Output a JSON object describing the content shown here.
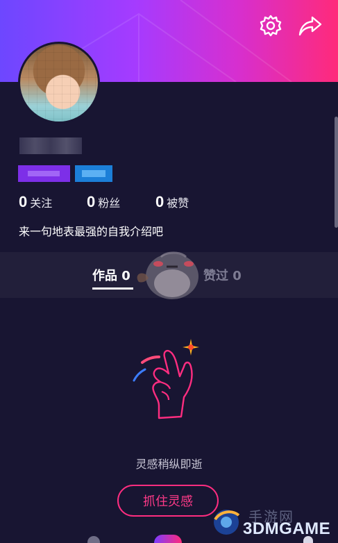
{
  "header": {
    "settings_icon": "gear-icon",
    "share_icon": "share-arrow-icon",
    "gradient_colors": [
      "#6d47ff",
      "#a53bff",
      "#ff2a7a"
    ]
  },
  "profile": {
    "avatar_icon": "avatar-pixelated",
    "stats": [
      {
        "count": "0",
        "label": "关注"
      },
      {
        "count": "0",
        "label": "粉丝"
      },
      {
        "count": "0",
        "label": "被赞"
      }
    ],
    "bio": "来一句地表最强的自我介绍吧"
  },
  "tabs": [
    {
      "label": "作品 0",
      "active": true
    },
    {
      "label": "赞过 0",
      "active": false
    }
  ],
  "empty_state": {
    "illustration": "snap-fingers-hand-icon",
    "message": "灵感稍纵即逝",
    "cta_label": "抓住灵感"
  },
  "watermark": {
    "text": "3DMGAME",
    "subtitle": "手游网"
  },
  "colors": {
    "background": "#181532",
    "tab_bar": "#221f3a",
    "accent": "#ff2d80"
  }
}
